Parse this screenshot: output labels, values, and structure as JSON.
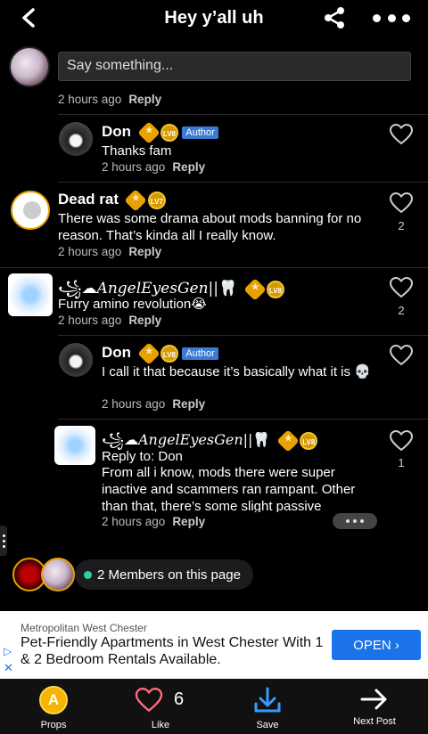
{
  "header": {
    "title": "Hey y’all uh"
  },
  "composer": {
    "placeholder": "Say something..."
  },
  "comments": [
    {
      "time": "2 hours ago",
      "reply": "Reply"
    },
    {
      "name": "Don",
      "level": "LV8",
      "author_label": "Author",
      "text": "Thanks fam",
      "time": "2 hours ago",
      "reply": "Reply",
      "likes": ""
    },
    {
      "name": "Dead rat",
      "level": "LV7",
      "text": "There was some drama about mods banning for no reason. That’s kinda all I really know.",
      "time": "2 hours ago",
      "reply": "Reply",
      "likes": "2"
    },
    {
      "name": "꧁☁︎𝐴𝑛𝑔𝑒𝑙𝐸𝑦𝑒𝑠𝐺𝑒𝑛||🦷",
      "level": "LV8",
      "text": "Furry amino revolution😭",
      "time": "2 hours ago",
      "reply": "Reply",
      "likes": "2"
    },
    {
      "name": "Don",
      "level": "LV8",
      "author_label": "Author",
      "text": "I call it that because it’s basically what it is 💀",
      "time": "2 hours ago",
      "reply": "Reply",
      "likes": ""
    },
    {
      "name": "꧁☁︎𝐴𝑛𝑔𝑒𝑙𝐸𝑦𝑒𝑠𝐺𝑒𝑛||🦷",
      "level": "LV8",
      "reply_to": "Reply to: Don",
      "text": "From all i know, mods there were super inactive and scammers ran rampant. Other than that, there’s some slight passive",
      "time": "2 hours ago",
      "reply": "Reply",
      "likes": "1"
    }
  ],
  "members": {
    "label": "2 Members on this page",
    "dot_color": "#2ed1a2"
  },
  "ad": {
    "source": "Metropolitan West Chester",
    "headline": "Pet-Friendly Apartments in West Chester With 1 & 2 Bedroom Rentals Available.",
    "cta": "OPEN",
    "info_icon": "▷",
    "close_icon": "✕"
  },
  "nav": {
    "props": "Props",
    "like": "Like",
    "like_count": "6",
    "save": "Save",
    "next": "Next Post"
  },
  "colors": {
    "badge_gold": "#e8a200",
    "author_blue": "#3a7bd5",
    "cta_blue": "#1a73e8"
  }
}
